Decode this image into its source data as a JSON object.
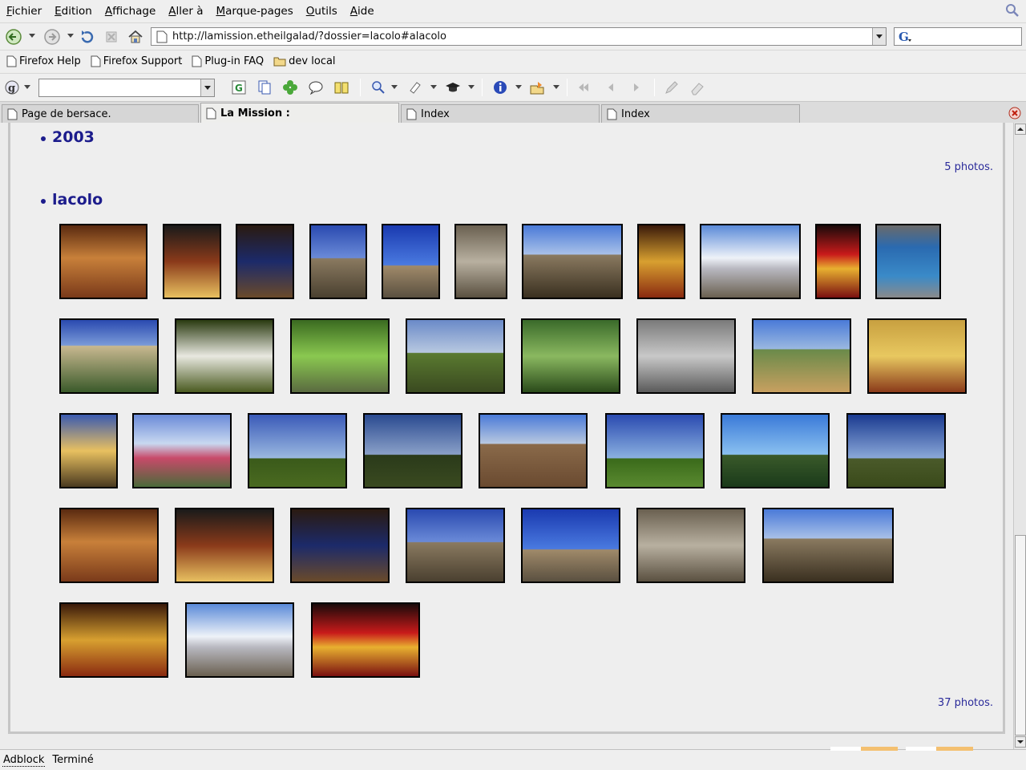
{
  "menu": [
    "Fichier",
    "Edition",
    "Affichage",
    "Aller à",
    "Marque-pages",
    "Outils",
    "Aide"
  ],
  "nav": {
    "url": "http://lamission.etheilgalad/?dossier=lacolo#alacolo",
    "search_value": ""
  },
  "bookmarks": [
    "Firefox Help",
    "Firefox Support",
    "Plug-in FAQ",
    "dev local"
  ],
  "google_toolbar": {
    "search_value": ""
  },
  "tabs": [
    "Page de bersace.",
    "La Mission :",
    "Index",
    "Index"
  ],
  "content": {
    "section1": {
      "title": "2003",
      "count": "5 photos."
    },
    "section2": {
      "title": "lacolo",
      "count": "37 photos."
    }
  },
  "status": {
    "adblock": "Adblock",
    "text": "Terminé"
  },
  "colors": {
    "link_blue": "#1c1c8c",
    "panel_border": "#c6c6c6"
  }
}
